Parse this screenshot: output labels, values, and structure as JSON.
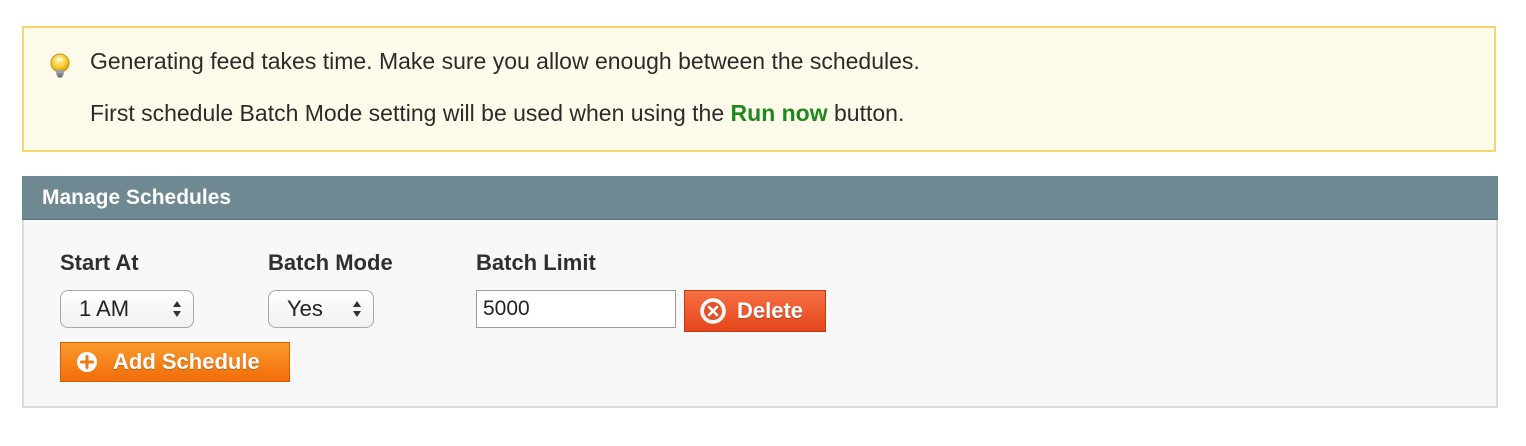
{
  "notice": {
    "icon": "lightbulb-icon",
    "line1": "Generating feed takes time. Make sure you allow enough between the schedules.",
    "line2_before": "First schedule Batch Mode setting will be used when using the ",
    "line2_highlight": "Run now",
    "line2_after": " button.",
    "highlight_color": "#1e8a1e",
    "background": "#fffbea",
    "border": "#f6d56b"
  },
  "panel": {
    "title": "Manage Schedules",
    "header_color": "#6f8992",
    "columns": {
      "start_at": "Start At",
      "batch_mode": "Batch Mode",
      "batch_limit": "Batch Limit"
    },
    "rows": [
      {
        "start_at": "1 AM",
        "batch_mode": "Yes",
        "batch_limit": "5000",
        "delete_label": "Delete"
      }
    ],
    "add_label": "Add Schedule",
    "delete_color": "#e6461c",
    "add_color": "#f26d0a"
  }
}
